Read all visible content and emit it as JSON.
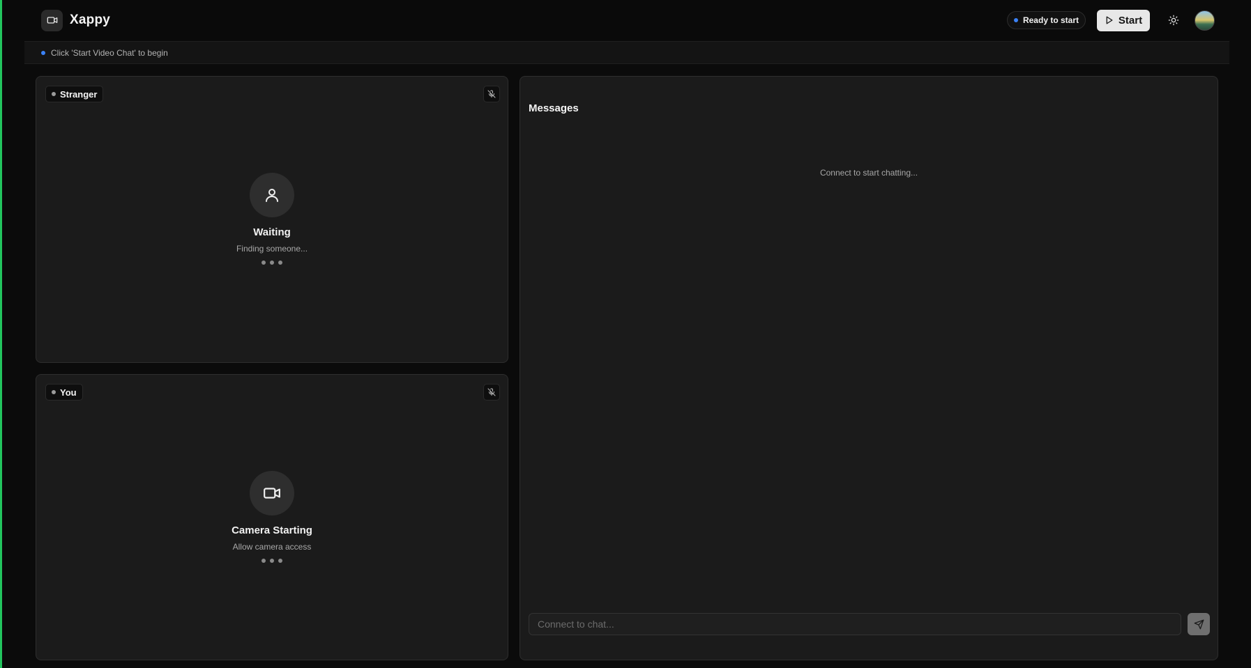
{
  "app": {
    "name": "Xappy",
    "logo_icon": "video-camera-icon"
  },
  "header": {
    "status_label": "Ready to start",
    "status_color": "#3b82f6",
    "start_label": "Start",
    "start_icon": "play-icon",
    "theme_icon": "sun-icon",
    "avatar_icon": "user-avatar"
  },
  "info_bar": {
    "text": "Click 'Start Video Chat' to begin",
    "dot_color": "#3b82f6"
  },
  "stranger_panel": {
    "tag_label": "Stranger",
    "mute_icon": "mic-off-icon",
    "placeholder_icon": "user-icon",
    "title": "Waiting",
    "subtitle": "Finding someone..."
  },
  "self_panel": {
    "tag_label": "You",
    "mute_icon": "mic-off-icon",
    "placeholder_icon": "video-camera-icon",
    "title": "Camera Starting",
    "subtitle": "Allow camera access"
  },
  "messages": {
    "title": "Messages",
    "empty_text": "Connect to start chatting...",
    "input_placeholder": "Connect to chat...",
    "send_icon": "send-icon"
  },
  "colors": {
    "accent_green": "#22c55e",
    "background": "#0b0b0b",
    "panel": "#1b1b1b"
  }
}
